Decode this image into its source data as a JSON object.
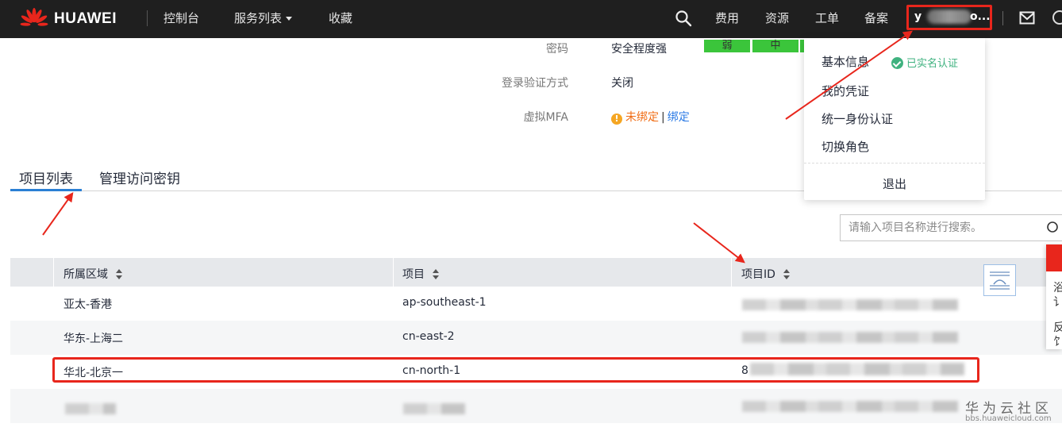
{
  "header": {
    "brand": "HUAWEI",
    "nav": [
      "控制台",
      "服务列表",
      "收藏"
    ],
    "right_items": [
      "费用",
      "资源",
      "工单",
      "备案"
    ],
    "user_initial": "y",
    "user_suffix": "o..."
  },
  "account_info": {
    "password_label": "密码",
    "password_value": "安全程度强",
    "strength_levels": [
      "弱",
      "中"
    ],
    "login_verify_label": "登录验证方式",
    "login_verify_value": "关闭",
    "mfa_label": "虚拟MFA",
    "mfa_status": "未绑定",
    "mfa_separator": "|",
    "mfa_action": "绑定"
  },
  "tabs": [
    "项目列表",
    "管理访问密钥"
  ],
  "search": {
    "placeholder": "请输入项目名称进行搜索。"
  },
  "table": {
    "columns": [
      "所属区域",
      "项目",
      "项目ID"
    ],
    "rows": [
      {
        "region": "亚太-香港",
        "project": "ap-southeast-1",
        "project_id": ""
      },
      {
        "region": "华东-上海二",
        "project": "cn-east-2",
        "project_id": ""
      },
      {
        "region": "华北-北京一",
        "project": "cn-north-1",
        "project_id": "8"
      },
      {
        "region": "",
        "project": "",
        "project_id": ""
      }
    ]
  },
  "user_menu": {
    "items": [
      "基本信息",
      "我的凭证",
      "统一身份认证",
      "切换角色"
    ],
    "verified_badge": "已实名认证",
    "logout": "退出"
  },
  "side_panel": {
    "chars": [
      "浴",
      "讠",
      "反",
      "饣"
    ]
  },
  "watermark": {
    "cn": "华为云社区",
    "en": "bbs.huaweicloud.com"
  },
  "colors": {
    "topbar": "#1f1f1f",
    "annotation_red": "#e8261c",
    "strength_green": "#3bc53b",
    "accent_blue": "#2a7fd4",
    "verified_green": "#3fb27f"
  }
}
